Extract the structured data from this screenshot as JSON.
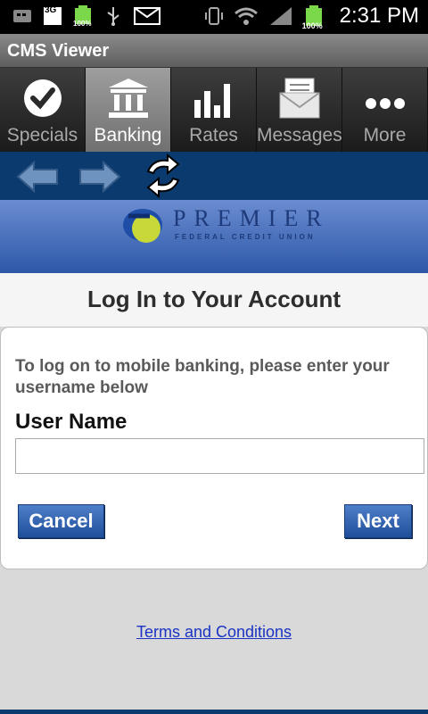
{
  "status_bar": {
    "network": "3G",
    "battery_small_label": "100%",
    "battery_label": "100%",
    "time": "2:31 PM"
  },
  "app": {
    "title": "CMS Viewer"
  },
  "tabs": [
    {
      "label": "Specials",
      "icon": "checkmark-icon",
      "active": false
    },
    {
      "label": "Banking",
      "icon": "bank-icon",
      "active": true
    },
    {
      "label": "Rates",
      "icon": "bar-chart-icon",
      "active": false
    },
    {
      "label": "Messages",
      "icon": "envelope-icon",
      "active": false
    },
    {
      "label": "More",
      "icon": "more-icon",
      "active": false
    }
  ],
  "banner": {
    "logo_word": "PREMIER",
    "logo_sub": "FEDERAL CREDIT UNION"
  },
  "login": {
    "title": "Log In to Your Account",
    "instructions": "To log on to mobile banking, please enter your username below",
    "username_label": "User Name",
    "username_value": "",
    "cancel_label": "Cancel",
    "next_label": "Next"
  },
  "footer": {
    "terms_label": "Terms and Conditions"
  },
  "colors": {
    "nav_dark_blue": "#0a3a6e",
    "button_blue": "#2b5aa6",
    "link_blue": "#1a33c4"
  }
}
